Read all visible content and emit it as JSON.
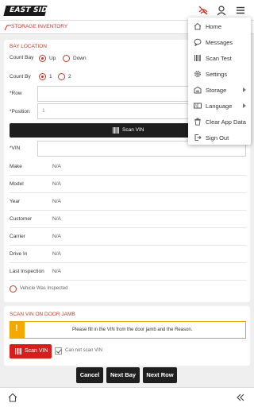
{
  "app": {
    "logo_text": "EAST SIDE"
  },
  "breadcrumb": {
    "text": "STORAGE INVENTORY"
  },
  "bay_location": {
    "title": "BAY LOCATION",
    "count_bay": {
      "label": "Count Bay",
      "options": [
        "Up",
        "Down"
      ],
      "selected": "Up"
    },
    "count_by": {
      "label": "Count By",
      "options": [
        "1",
        "2"
      ],
      "selected": "1"
    },
    "row": {
      "label": "*Row",
      "value": ""
    },
    "position": {
      "label": "*Position",
      "value": "1"
    },
    "scan_vin_label": "Scan VIN",
    "vin": {
      "label": "*VIN",
      "value": ""
    },
    "fields": [
      {
        "label": "Make",
        "value": "N/A"
      },
      {
        "label": "Model",
        "value": "N/A"
      },
      {
        "label": "Year",
        "value": "N/A"
      },
      {
        "label": "Customer",
        "value": "N/A"
      },
      {
        "label": "Carrier",
        "value": "N/A"
      },
      {
        "label": "Drive In",
        "value": "N/A"
      },
      {
        "label": "Last Inspection",
        "value": "N/A"
      }
    ],
    "vehicle_inspected_label": "Vehicle Was Inspected"
  },
  "door_jamb": {
    "title": "SCAN VIN ON DOOR JAMB",
    "warning": "Please fill in the VIN from the door jamb and the Reason.",
    "scan_vin_label": "Scan VIN",
    "cannot_scan_label": "Can not scan VIN"
  },
  "actions": {
    "cancel": "Cancel",
    "next_bay": "Next Bay",
    "next_row": "Next Row"
  },
  "menu": {
    "items": [
      {
        "label": "Home",
        "icon": "home-icon",
        "submenu": false
      },
      {
        "label": "Messages",
        "icon": "chat-icon",
        "submenu": false
      },
      {
        "label": "Scan Test",
        "icon": "barcode-icon",
        "submenu": false
      },
      {
        "label": "Settings",
        "icon": "gear-icon",
        "submenu": false
      },
      {
        "label": "Storage",
        "icon": "warehouse-icon",
        "submenu": true
      },
      {
        "label": "Language",
        "icon": "language-icon",
        "submenu": true
      },
      {
        "label": "Clear App Data",
        "icon": "trash-icon",
        "submenu": false
      },
      {
        "label": "Sign Out",
        "icon": "sign-out-icon",
        "submenu": false
      }
    ]
  },
  "colors": {
    "accent": "#c03a2b",
    "scan_red": "#d91c1c",
    "dark": "#1f1f1f",
    "warning": "#f5a800"
  }
}
